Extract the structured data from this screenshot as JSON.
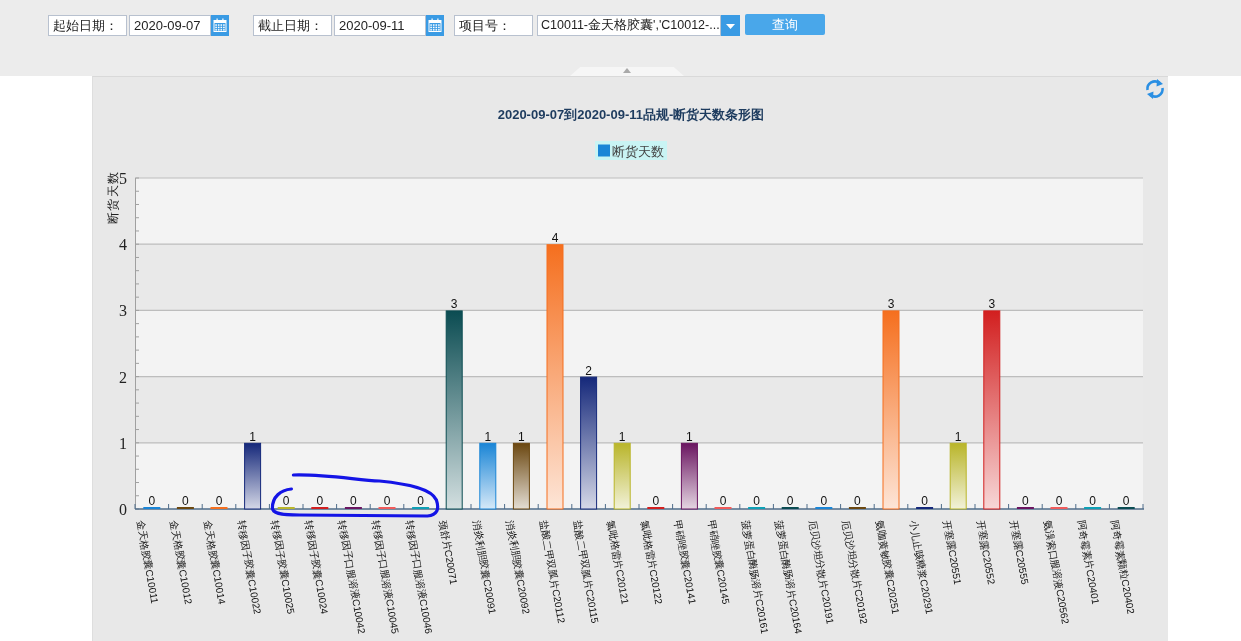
{
  "filters": [
    {
      "kind": "date",
      "label": "起始日期：",
      "value": "2020-09-07"
    },
    {
      "kind": "date",
      "label": "截止日期：",
      "value": "2020-09-11"
    },
    {
      "kind": "select",
      "label": "项目号：",
      "value": "C10011-金天格胶囊','C10012-..."
    }
  ],
  "query_button": {
    "label": "查询"
  },
  "chart": {
    "chart_data": {
      "type": "bar",
      "title": "2020-09-07到2020-09-11品规-断货天数条形图",
      "ylabel": "断货天数",
      "categories": [
        "金天格胶囊C10011",
        "金天格胶囊C10012",
        "金天格胶囊C10014",
        "转移因子胶囊C10022",
        "转移因子胶囊C10025",
        "转移因子胶囊C10024",
        "转移因子口服溶液C10042",
        "转移因子口服溶液C10045",
        "转移因子口服溶液C10046",
        "颈舒片C20071",
        "消炎利胆胶囊C20091",
        "消炎利胆胶囊C20092",
        "盐酸二甲双胍片C20112",
        "盐酸二甲双胍片C20115",
        "氯吡格雷片C20121",
        "氯吡格雷片C20122",
        "甲硝唑胶囊C20141",
        "甲硝唑胶囊C20145",
        "菠萝蛋白酶肠溶片C20161",
        "菠萝蛋白酶肠溶片C20164",
        "厄贝沙坦分散片C20191",
        "厄贝沙坦分散片C20192",
        "氨咖黄敏胶囊C20251",
        "小儿止咳糖浆C20291",
        "开塞露C20551",
        "开塞露C20552",
        "开塞露C20555",
        "氨溴索口服溶液C20562",
        "阿奇霉素片C20401",
        "阿奇霉素颗粒C20402"
      ],
      "series": [
        {
          "name": "断货天数",
          "values": [
            0,
            0,
            0,
            1,
            0,
            0,
            0,
            0,
            0,
            3,
            1,
            1,
            4,
            2,
            1,
            0,
            1,
            0,
            0,
            0,
            0,
            0,
            3,
            0,
            1,
            3,
            0,
            0,
            0,
            0
          ]
        }
      ],
      "ylim": [
        0,
        5
      ],
      "yticks": [
        0,
        1,
        2,
        3,
        4,
        5
      ],
      "grid": true,
      "data_labels": true
    }
  }
}
